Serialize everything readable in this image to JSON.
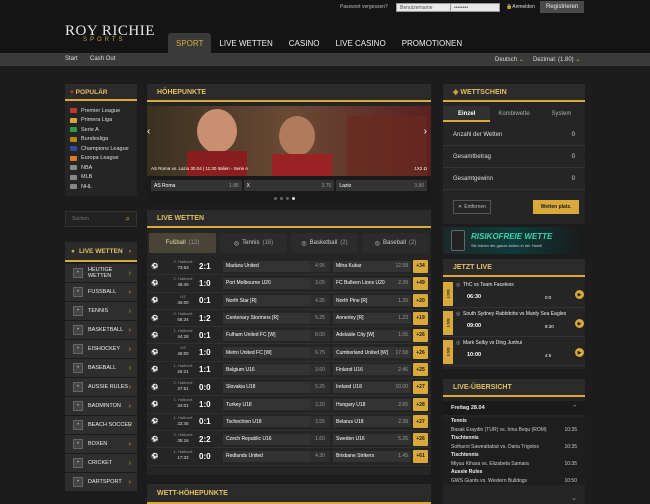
{
  "header": {
    "logo_main": "ROY RICHIE",
    "logo_sub": "SPORTS",
    "forgot": "Passwort vergessen?",
    "username_placeholder": "Benutzername",
    "password_placeholder": "••••••••",
    "login": "Anmelden",
    "register": "Registrieren"
  },
  "nav": [
    "SPORT",
    "LIVE WETTEN",
    "CASINO",
    "LIVE CASINO",
    "PROMOTIONEN"
  ],
  "subnav": {
    "start": "Start",
    "cashout": "Cash Out",
    "language": "Deutsch",
    "odds": "Dezimal: (1.80)"
  },
  "popular": {
    "title": "POPULÄR",
    "items": [
      {
        "label": "Premier League",
        "color": "#c0392b"
      },
      {
        "label": "Primera Liga",
        "color": "#d9aa3b"
      },
      {
        "label": "Serie A",
        "color": "#2a9d46"
      },
      {
        "label": "Bundesliga",
        "color": "#b8860b"
      },
      {
        "label": "Champions League",
        "color": "#2d4aa8"
      },
      {
        "label": "Europa League",
        "color": "#e07b22"
      },
      {
        "label": "NBA",
        "color": "#888888"
      },
      {
        "label": "MLB",
        "color": "#888888"
      },
      {
        "label": "NHL",
        "color": "#888888"
      }
    ]
  },
  "search": {
    "placeholder": "Suchen"
  },
  "sports_title": "LIVE WETTEN",
  "sports": [
    "HEUTIGE WETTEN",
    "FUSSBALL",
    "TENNIS",
    "BASKETBALL",
    "EISHOCKEY",
    "BASEBALL",
    "AUSSIE RULES",
    "BADMINTON",
    "BEACH SOCCER",
    "BOXEN",
    "CRICKET",
    "DARTSPORT"
  ],
  "highlights": {
    "title": "HÖHEPUNKTE",
    "caption": "AS Roma vs. Lazio  30.04 | 11:30 Italien - Serie A",
    "caption_right": "1X2 Ω",
    "odds": [
      {
        "label": "AS Roma",
        "odd": "1.86"
      },
      {
        "label": "X",
        "odd": "3.75"
      },
      {
        "label": "Lazio",
        "odd": "3.90"
      }
    ]
  },
  "live": {
    "title": "LIVE WETTEN",
    "tabs": [
      {
        "label": "Fußball",
        "count": "(12)"
      },
      {
        "label": "Tennis",
        "count": "(16)"
      },
      {
        "label": "Basketball",
        "count": "(2)"
      },
      {
        "label": "Baseball",
        "count": "(2)"
      }
    ],
    "matches": [
      {
        "period": "2. Halbzeit",
        "time": "73:53",
        "score": "2:1",
        "home": "Madura United",
        "o1": "1.15",
        "ox": "4.95",
        "away": "Mitra Kukar",
        "o2": "12.58",
        "more": "+34"
      },
      {
        "period": "2. Halbzeit",
        "time": "48:49",
        "score": "1:0",
        "home": "Port Melbourne U20",
        "o1": "3.10",
        "ox": "3.05",
        "away": "FC Bulleen Lions U20",
        "o2": "2.39",
        "more": "+49"
      },
      {
        "period": "HZ",
        "time": "45:00",
        "score": "0:1",
        "home": "North Star [R]",
        "o1": "6.55",
        "ox": "4.35",
        "away": "North Pine [R]",
        "o2": "1.20",
        "more": "+20"
      },
      {
        "period": "2. Halbzeit",
        "time": "58:24",
        "score": "1:2",
        "home": "Centenary Stormers [R]",
        "o1": "8.25",
        "ox": "5.25",
        "away": "Annerley [R]",
        "o2": "1.23",
        "more": "+19"
      },
      {
        "period": "1. Halbzeit",
        "time": "44:28",
        "score": "0:1",
        "home": "Fulham United FC [W]",
        "o1": "17.00",
        "ox": "8.00",
        "away": "Adelaide City [W]",
        "o2": "1.05",
        "more": "+26"
      },
      {
        "period": "HZ",
        "time": "45:00",
        "score": "1:0",
        "home": "Metro United FC [W]",
        "o1": "1.05",
        "ox": "6.75",
        "away": "Cumberland United [W]",
        "o2": "17.58",
        "more": "+26"
      },
      {
        "period": "1. Halbzeit",
        "time": "26:21",
        "score": "1:1",
        "home": "Belgium U16",
        "o1": "3.10",
        "ox": "3.60",
        "away": "Finland U16",
        "o2": "2.46",
        "more": "+25"
      },
      {
        "period": "2. Halbzeit",
        "time": "37:51",
        "score": "0:0",
        "home": "Slovakia U18",
        "o1": "1.23",
        "ox": "5.25",
        "away": "Ireland U18",
        "o2": "10.00",
        "more": "+27"
      },
      {
        "period": "1. Halbzeit",
        "time": "34:01",
        "score": "1:0",
        "home": "Turkey U18",
        "o1": "2.70",
        "ox": "3.20",
        "away": "Hungary U18",
        "o2": "2.65",
        "more": "+28"
      },
      {
        "period": "1. Halbzeit",
        "time": "22:45",
        "score": "0:1",
        "home": "Tschechien U18",
        "o1": "8.50",
        "ox": "3.55",
        "away": "Belarus U18",
        "o2": "2.38",
        "more": "+27"
      },
      {
        "period": "2. Halbzeit",
        "time": "35:16",
        "score": "2:2",
        "home": "Czech Republic U16",
        "o1": "5.25",
        "ox": "1.60",
        "away": "Sweden U16",
        "o2": "5.25",
        "more": "+26"
      },
      {
        "period": "1. Halbzeit",
        "time": "17:32",
        "score": "0:0",
        "home": "Redlands United",
        "o1": "5.95",
        "ox": "4.30",
        "away": "Brisbane Strikers",
        "o2": "1.45",
        "more": "+61"
      }
    ]
  },
  "wett_title": "WETT-HÖHEPUNKTE",
  "betslip": {
    "title": "WETTSCHEIN",
    "tabs": [
      "Einzel",
      "Kombiwette",
      "System"
    ],
    "rows": [
      {
        "label": "Anzahl der Wetten",
        "value": "0"
      },
      {
        "label": "Gesamtbetrag",
        "value": "0"
      },
      {
        "label": "Gesamtgewinn",
        "value": "0"
      }
    ],
    "clear": "Entfernen",
    "place": "Wetten platz."
  },
  "banner": {
    "title": "RISIKOFREIE WETTE",
    "sub": "Sie haben die ganze Action in der Hand!"
  },
  "jetzt": {
    "title": "JETZT LIVE",
    "items": [
      {
        "match": "ThC vs Team Faceless",
        "time": "06:30",
        "score": "0:0"
      },
      {
        "match": "South Sydney Rabbitohs vs Manly Sea Eagles",
        "time": "09:00",
        "score": "8:30"
      },
      {
        "match": "Mark Selby vs Ding Junhui",
        "time": "10:00",
        "score": "4:5"
      }
    ],
    "badge": "LIVE"
  },
  "overview": {
    "title": "LIVE-ÜBERSICHT",
    "date": "Freitag 28.04",
    "groups": [
      {
        "sport": "Tennis",
        "rows": [
          {
            "m": "Basak Eraydin (TUR) vs. Irina Bequ (ROM)",
            "t": "10:35"
          }
        ]
      },
      {
        "sport": "Tischtennis",
        "rows": [
          {
            "m": "Sotharoi Saweattabut vs. Daria Trigolos",
            "t": "10:35"
          }
        ]
      },
      {
        "sport": "Tischtennis",
        "rows": [
          {
            "m": "Miyuu Kihara vs. Elizabeta Samara",
            "t": "10:35"
          }
        ]
      },
      {
        "sport": "Aussie Rules",
        "rows": [
          {
            "m": "GWS Giants vs. Western Bulldogs",
            "t": "10:50"
          }
        ]
      }
    ]
  },
  "colors": {
    "accent": "#d9aa3b",
    "panel": "#252525"
  }
}
